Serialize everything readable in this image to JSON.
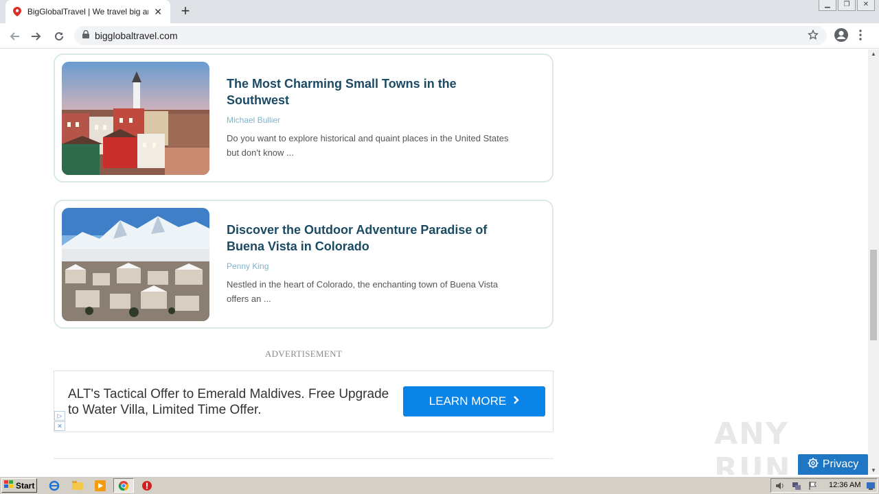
{
  "browser": {
    "tab_title": "BigGlobalTravel | We travel big and c",
    "new_tab_symbol": "+",
    "url": "bigglobaltravel.com"
  },
  "articles": [
    {
      "title": "The Most Charming Small Towns in the Southwest",
      "author": "Michael Bullier",
      "excerpt": "Do you want to explore historical and quaint places in the United States but don't know ..."
    },
    {
      "title": "Discover the Outdoor Adventure Paradise of Buena Vista in Colorado",
      "author": "Penny King",
      "excerpt": "Nestled in the heart of Colorado, the enchanting town of Buena Vista offers an ..."
    }
  ],
  "advertisement": {
    "label": "ADVERTISEMENT",
    "text": "ALT's Tactical Offer to Emerald Maldives. Free Upgrade to Water Villa, Limited Time Offer.",
    "button_label": "LEARN MORE"
  },
  "watermark": "ANY RUN",
  "privacy_label": "Privacy",
  "taskbar": {
    "start_label": "Start",
    "clock": "12:36 AM"
  },
  "colors": {
    "title": "#1b4a64",
    "author": "#7fb3c9",
    "card_border": "#dbe8ea",
    "ad_button": "#0a84e6",
    "privacy_button": "#1f76c2"
  }
}
